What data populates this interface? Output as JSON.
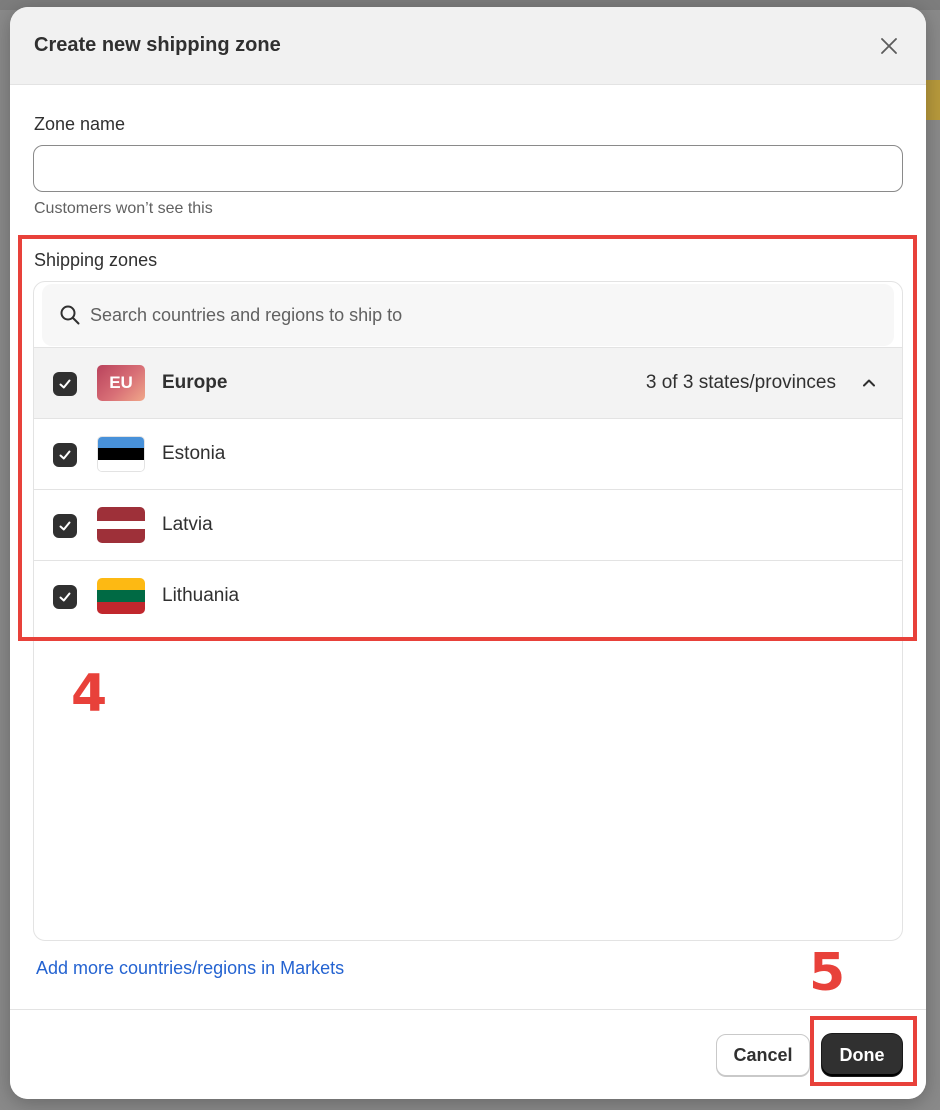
{
  "modal": {
    "title": "Create new shipping zone",
    "close_icon": "close-icon"
  },
  "zone_name": {
    "label": "Zone name",
    "value": "",
    "placeholder": "",
    "help_text": "Customers won’t see this"
  },
  "shipping_zones": {
    "label": "Shipping zones",
    "search_placeholder": "Search countries and regions to ship to",
    "search_icon": "search-icon",
    "group": {
      "flag_text": "EU",
      "label": "Europe",
      "count_text": "3 of 3 states/provinces",
      "checked": true,
      "expanded": true,
      "chevron_icon": "chevron-up-icon"
    },
    "countries": [
      {
        "name": "Estonia",
        "checked": true,
        "flag_colors": [
          "#4891d9",
          "#000000",
          "#ffffff"
        ]
      },
      {
        "name": "Latvia",
        "checked": true,
        "flag_colors": [
          "#9e3039",
          "#ffffff",
          "#9e3039"
        ]
      },
      {
        "name": "Lithuania",
        "checked": true,
        "flag_colors": [
          "#fdb913",
          "#006a44",
          "#c1272d"
        ]
      }
    ],
    "add_link": "Add more countries/regions in Markets"
  },
  "footer": {
    "cancel_label": "Cancel",
    "done_label": "Done"
  },
  "annotations": [
    {
      "label": "4",
      "color": "#e8413a"
    },
    {
      "label": "5",
      "color": "#e8413a"
    }
  ]
}
